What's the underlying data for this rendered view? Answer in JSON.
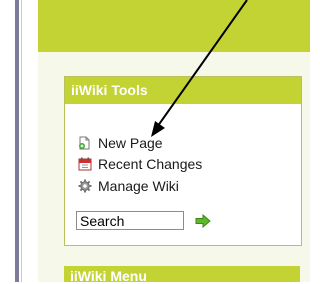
{
  "tools": {
    "title": "iiWiki Tools",
    "links": [
      {
        "label": "New Page",
        "icon": "new-page-icon"
      },
      {
        "label": "Recent Changes",
        "icon": "calendar-icon"
      },
      {
        "label": "Manage Wiki",
        "icon": "gear-icon"
      }
    ],
    "search_value": "Search",
    "go_icon": "green-arrow-icon"
  },
  "menu": {
    "title": "iiWiki Menu"
  },
  "annotation": {
    "icon": "pointer-arrow"
  },
  "colors": {
    "accent": "#c4d334",
    "panel_bg": "#f6f8ea",
    "border": "#b9c25a"
  }
}
